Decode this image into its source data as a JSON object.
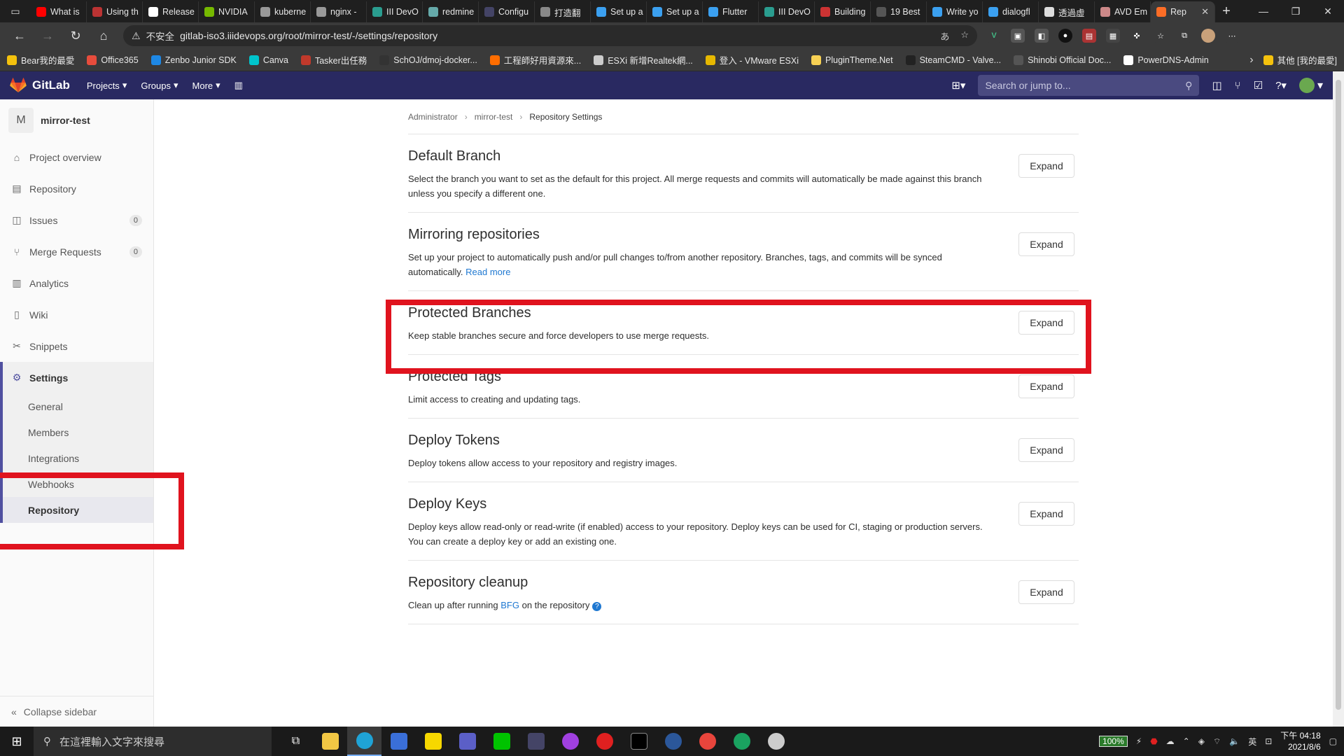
{
  "browser": {
    "tabs": [
      {
        "label": "What is",
        "color": "#ff0000"
      },
      {
        "label": "Using th",
        "color": "#b33"
      },
      {
        "label": "Release",
        "color": "#fff"
      },
      {
        "label": "NVIDIA",
        "color": "#76b900"
      },
      {
        "label": "kuberne",
        "color": "#999"
      },
      {
        "label": "nginx -",
        "color": "#999"
      },
      {
        "label": "III DevO",
        "color": "#2a9d8f"
      },
      {
        "label": "redmine",
        "color": "#6aa"
      },
      {
        "label": "Configu",
        "color": "#446"
      },
      {
        "label": "打造翻",
        "color": "#888"
      },
      {
        "label": "Set up a",
        "color": "#3ba0f0"
      },
      {
        "label": "Set up a",
        "color": "#3ba0f0"
      },
      {
        "label": "Flutter",
        "color": "#3ba0f0"
      },
      {
        "label": "III DevO",
        "color": "#2a9d8f"
      },
      {
        "label": "Building",
        "color": "#c33"
      },
      {
        "label": "19 Best",
        "color": "#555"
      },
      {
        "label": "Write yo",
        "color": "#3ba0f0"
      },
      {
        "label": "dialogfl",
        "color": "#3ba0f0"
      },
      {
        "label": "透過虛",
        "color": "#ddd"
      },
      {
        "label": "AVD Em",
        "color": "#c88"
      },
      {
        "label": "Rep",
        "color": "#fc6d26",
        "active": true
      }
    ],
    "insecure_label": "不安全",
    "url": "gitlab-iso3.iiidevops.org/root/mirror-test/-/settings/repository",
    "bookmarks": [
      {
        "label": "Bear我的最愛",
        "color": "#f4c20d"
      },
      {
        "label": "Office365",
        "color": "#e74c3c"
      },
      {
        "label": "Zenbo Junior SDK",
        "color": "#1e88e5"
      },
      {
        "label": "Canva",
        "color": "#00c4cc"
      },
      {
        "label": "Tasker出任務",
        "color": "#c0392b"
      },
      {
        "label": "SchOJ/dmoj-docker...",
        "color": "#333"
      },
      {
        "label": "工程師好用資源來...",
        "color": "#ff6d00"
      },
      {
        "label": "ESXi 新增Realtek網...",
        "color": "#ccc"
      },
      {
        "label": "登入 - VMware ESXi",
        "color": "#e6b800"
      },
      {
        "label": "PluginTheme.Net",
        "color": "#f7d154"
      },
      {
        "label": "SteamCMD - Valve...",
        "color": "#222"
      },
      {
        "label": "Shinobi Official Doc...",
        "color": "#555"
      },
      {
        "label": "PowerDNS-Admin",
        "color": "#fff"
      }
    ],
    "other_bookmarks": "其他 [我的最愛]"
  },
  "gitlab_nav": {
    "brand": "GitLab",
    "menu": [
      "Projects",
      "Groups",
      "More"
    ],
    "search_placeholder": "Search or jump to..."
  },
  "sidebar": {
    "project_initial": "M",
    "project_name": "mirror-test",
    "items": [
      {
        "label": "Project overview",
        "icon": "home-icon"
      },
      {
        "label": "Repository",
        "icon": "document-icon"
      },
      {
        "label": "Issues",
        "icon": "issues-icon",
        "count": "0"
      },
      {
        "label": "Merge Requests",
        "icon": "merge-icon",
        "count": "0"
      },
      {
        "label": "Analytics",
        "icon": "chart-icon"
      },
      {
        "label": "Wiki",
        "icon": "book-icon"
      },
      {
        "label": "Snippets",
        "icon": "scissors-icon"
      }
    ],
    "settings_label": "Settings",
    "settings_sub": [
      "General",
      "Members",
      "Integrations",
      "Webhooks",
      "Repository"
    ],
    "collapse_label": "Collapse sidebar"
  },
  "breadcrumb": [
    "Administrator",
    "mirror-test",
    "Repository Settings"
  ],
  "sections": [
    {
      "title": "Default Branch",
      "desc": "Select the branch you want to set as the default for this project. All merge requests and commits will automatically be made against this branch unless you specify a different one."
    },
    {
      "title": "Mirroring repositories",
      "desc": "Set up your project to automatically push and/or pull changes to/from another repository. Branches, tags, and commits will be synced automatically.",
      "link": "Read more"
    },
    {
      "title": "Protected Branches",
      "desc": "Keep stable branches secure and force developers to use merge requests."
    },
    {
      "title": "Protected Tags",
      "desc": "Limit access to creating and updating tags."
    },
    {
      "title": "Deploy Tokens",
      "desc": "Deploy tokens allow access to your repository and registry images."
    },
    {
      "title": "Deploy Keys",
      "desc": "Deploy keys allow read-only or read-write (if enabled) access to your repository. Deploy keys can be used for CI, staging or production servers. You can create a deploy key or add an existing one."
    },
    {
      "title": "Repository cleanup",
      "desc_pre": "Clean up after running ",
      "link": "BFG",
      "desc_post": " on the repository"
    }
  ],
  "expand_label": "Expand",
  "taskbar": {
    "search_placeholder": "在這裡輸入文字來搜尋",
    "battery": "100%",
    "ime": "英",
    "time": "下午 04:18",
    "date": "2021/8/6"
  }
}
